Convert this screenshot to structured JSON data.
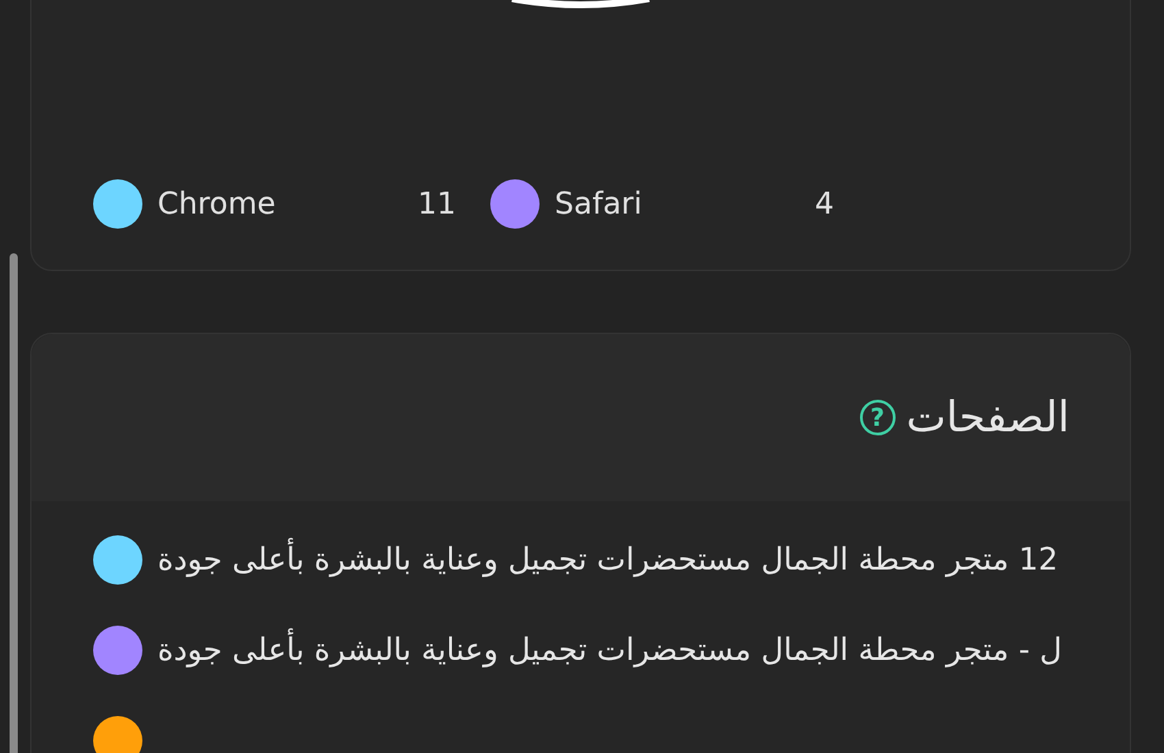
{
  "browsers_card": {
    "legend": [
      {
        "name": "Safari",
        "count": "4",
        "color": "#a185ff"
      },
      {
        "name": "Chrome",
        "count": "11",
        "color": "#6dd5ff"
      }
    ]
  },
  "pages_card": {
    "title": "الصفحات",
    "help_icon": "?",
    "rows": [
      {
        "label": "12 متجر محطة الجمال مستحضرات تجميل وعناية بالبشرة بأعلى جودة",
        "color": "#6dd5ff"
      },
      {
        "label": "ل - متجر محطة الجمال مستحضرات تجميل وعناية بالبشرة بأعلى جودة",
        "color": "#a185ff"
      },
      {
        "color": "#ff9f0a"
      }
    ]
  }
}
